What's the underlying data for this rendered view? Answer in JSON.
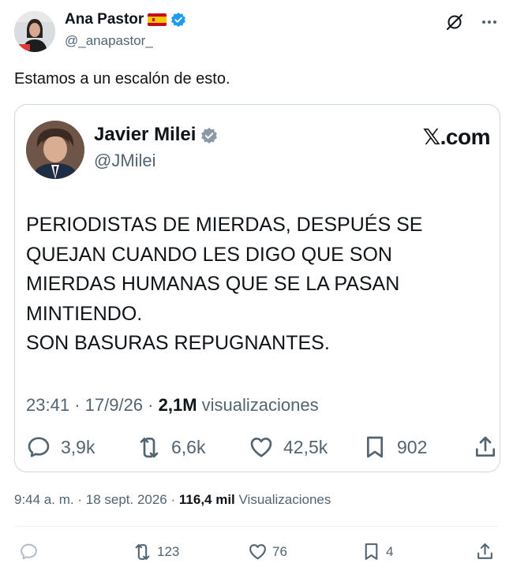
{
  "post": {
    "author_name": "Ana Pastor",
    "author_handle": "@_anapastor_",
    "text": "Estamos a un escalón de esto.",
    "timestamp": "9:44 a. m.",
    "date": "18 sept. 2026",
    "views_count": "116,4 mil",
    "views_label": "Visualizaciones",
    "stats": {
      "replies": "",
      "reposts": "123",
      "likes": "76",
      "bookmarks": "4"
    }
  },
  "quoted": {
    "author_name": "Javier Milei",
    "author_handle": "@JMilei",
    "brand": "𝕏.com",
    "text": "PERIODISTAS DE MIERDAS, DESPUÉS SE\nQUEJAN CUANDO LES DIGO QUE SON\nMIERDAS HUMANAS QUE SE LA PASAN\nMINTIENDO.\nSON BASURAS REPUGNANTES.",
    "time": "23:41",
    "date": "17/9/26",
    "views_count": "2,1M",
    "views_label": "visualizaciones",
    "stats": {
      "replies": "3,9k",
      "reposts": "6,6k",
      "likes": "42,5k",
      "bookmarks": "902"
    }
  },
  "colors": {
    "text": "#0f1419",
    "muted": "#536471",
    "verified": "#1d9bf0",
    "border": "#cfd9de"
  },
  "icons": [
    "spain-flag-icon",
    "verified-badge-icon",
    "grok-icon",
    "more-icon",
    "reply-icon",
    "repost-icon",
    "like-icon",
    "bookmark-icon",
    "share-icon"
  ]
}
